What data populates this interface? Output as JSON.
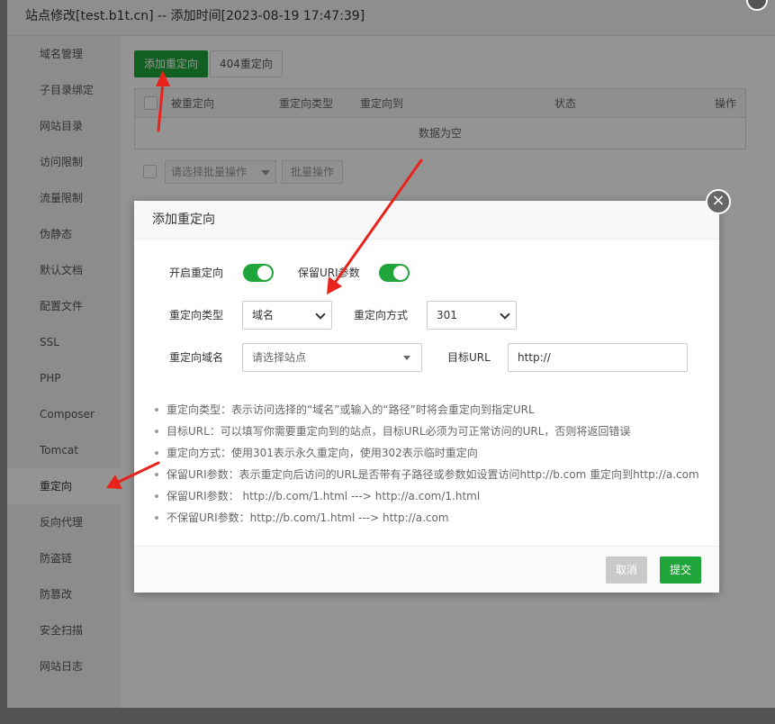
{
  "window": {
    "title": "站点修改[test.b1t.cn] -- 添加时间[2023-08-19 17:47:39]"
  },
  "sidebar": {
    "items": [
      {
        "label": "域名管理"
      },
      {
        "label": "子目录绑定"
      },
      {
        "label": "网站目录"
      },
      {
        "label": "访问限制"
      },
      {
        "label": "流量限制"
      },
      {
        "label": "伪静态"
      },
      {
        "label": "默认文档"
      },
      {
        "label": "配置文件"
      },
      {
        "label": "SSL"
      },
      {
        "label": "PHP"
      },
      {
        "label": "Composer"
      },
      {
        "label": "Tomcat"
      },
      {
        "label": "重定向"
      },
      {
        "label": "反向代理"
      },
      {
        "label": "防盗链"
      },
      {
        "label": "防篡改"
      },
      {
        "label": "安全扫描"
      },
      {
        "label": "网站日志"
      }
    ],
    "active": "重定向"
  },
  "main": {
    "add_button": "添加重定向",
    "not_found_button": "404重定向",
    "table": {
      "columns": [
        "被重定向",
        "重定向类型",
        "重定向到",
        "状态",
        "操作"
      ],
      "empty_text": "数据为空"
    },
    "batch": {
      "select_placeholder": "请选择批量操作",
      "button": "批量操作"
    }
  },
  "modal": {
    "title": "添加重定向",
    "enable_label": "开启重定向",
    "keep_uri_label": "保留URI参数",
    "enable_on": true,
    "keep_uri_on": true,
    "type_label": "重定向类型",
    "type_value": "域名",
    "method_label": "重定向方式",
    "method_value": "301",
    "domain_label": "重定向域名",
    "domain_placeholder": "请选择站点",
    "target_label": "目标URL",
    "target_value": "http://",
    "notes": [
      "重定向类型：表示访问选择的“域名”或输入的“路径”时将会重定向到指定URL",
      "目标URL：可以填写你需要重定向到的站点，目标URL必须为可正常访问的URL，否则将返回错误",
      "重定向方式：使用301表示永久重定向，使用302表示临时重定向",
      "保留URI参数：表示重定向后访问的URL是否带有子路径或参数如设置访问http://b.com 重定向到http://a.com",
      "保留URI参数： http://b.com/1.html ---> http://a.com/1.html",
      "不保留URI参数：http://b.com/1.html ---> http://a.com"
    ],
    "cancel_button": "取消",
    "submit_button": "提交"
  },
  "colors": {
    "primary_green": "#20a53a",
    "annotation_red": "#e8231b"
  }
}
